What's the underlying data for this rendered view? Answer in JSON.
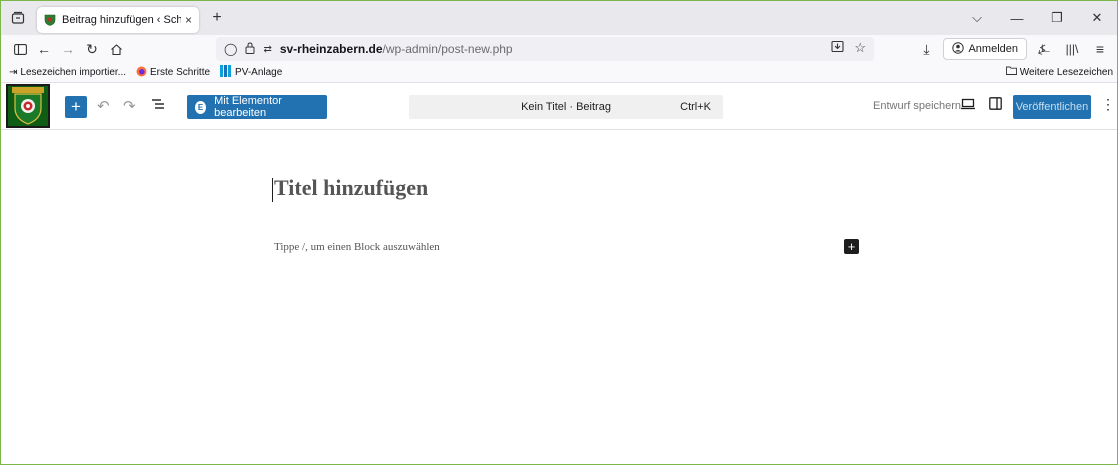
{
  "browser": {
    "tab": {
      "title": "Beitrag hinzufügen ‹ Schützenv",
      "close": "×"
    },
    "new_tab": "+",
    "url": {
      "host": "sv-rheinzabern.de",
      "path": "/wp-admin/post-new.php"
    },
    "signin_label": "Anmelden",
    "bookmarks": [
      {
        "label": "Lesezeichen importier..."
      },
      {
        "label": "Erste Schritte"
      },
      {
        "label": "PV-Anlage"
      }
    ],
    "other_bookmarks": "Weitere Lesezeichen"
  },
  "editor": {
    "inserter": "+",
    "elementor_label": "Mit Elementor bearbeiten",
    "command_bar": {
      "label": "Kein Titel · Beitrag",
      "shortcut": "Ctrl+K"
    },
    "save_draft": "Entwurf speichern",
    "publish": "Veröffentlichen",
    "title_placeholder": "Titel hinzufügen",
    "block_hint": "Tippe /, um einen Block auszuwählen",
    "block_add": "+"
  },
  "colors": {
    "wp_blue": "#2271b1",
    "frame_green": "#7ab648"
  }
}
